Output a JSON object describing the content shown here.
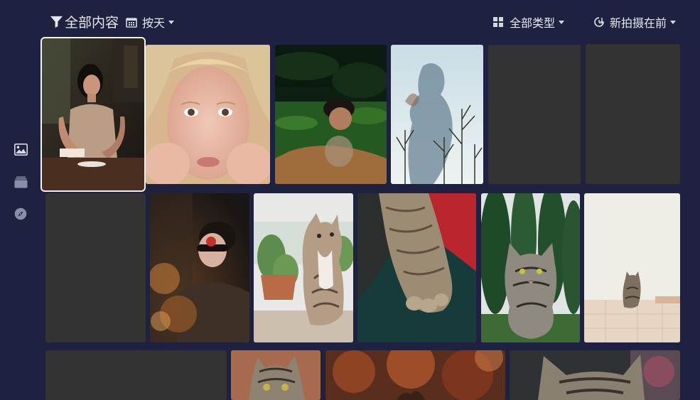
{
  "toolbar": {
    "filter_label": "全部内容",
    "group_label": "按天",
    "type_label": "全部类型",
    "sort_label": "新拍摄在前"
  },
  "sidenav": {
    "items": [
      {
        "name": "photos",
        "icon": "image-icon",
        "active": true
      },
      {
        "name": "albums",
        "icon": "albums-icon",
        "active": false
      },
      {
        "name": "explore",
        "icon": "compass-icon",
        "active": false
      }
    ]
  },
  "photos": [
    {
      "id": "p1",
      "subject": "woman-in-cafe",
      "selected": true,
      "placeholder": false
    },
    {
      "id": "p2",
      "subject": "blonde-woman-face",
      "selected": false,
      "placeholder": false
    },
    {
      "id": "p3",
      "subject": "woman-in-green-water",
      "selected": false,
      "placeholder": false
    },
    {
      "id": "p4",
      "subject": "double-exposure-trees",
      "selected": false,
      "placeholder": false
    },
    {
      "id": "p5",
      "subject": "",
      "selected": false,
      "placeholder": true
    },
    {
      "id": "p6",
      "subject": "",
      "selected": false,
      "placeholder": true
    },
    {
      "id": "p7",
      "subject": "",
      "selected": false,
      "placeholder": true
    },
    {
      "id": "p8",
      "subject": "woman-with-sunglasses",
      "selected": false,
      "placeholder": false
    },
    {
      "id": "p9",
      "subject": "cat-with-cactus",
      "selected": false,
      "placeholder": false
    },
    {
      "id": "p10",
      "subject": "cat-paw",
      "selected": false,
      "placeholder": false
    },
    {
      "id": "p11",
      "subject": "tabby-cat-in-garden",
      "selected": false,
      "placeholder": false
    },
    {
      "id": "p12",
      "subject": "cat-by-white-wall",
      "selected": false,
      "placeholder": false
    },
    {
      "id": "p13",
      "subject": "",
      "selected": false,
      "placeholder": true
    },
    {
      "id": "p14",
      "subject": "cat-face-closeup",
      "selected": false,
      "placeholder": false
    },
    {
      "id": "p15",
      "subject": "orange-bokeh",
      "selected": false,
      "placeholder": false
    },
    {
      "id": "p16",
      "subject": "cat-head-top",
      "selected": false,
      "placeholder": false
    }
  ],
  "colors": {
    "background": "#1f2140",
    "placeholder": "#333333",
    "text": "#e6e7ef",
    "selection": "#f2f2f2"
  }
}
